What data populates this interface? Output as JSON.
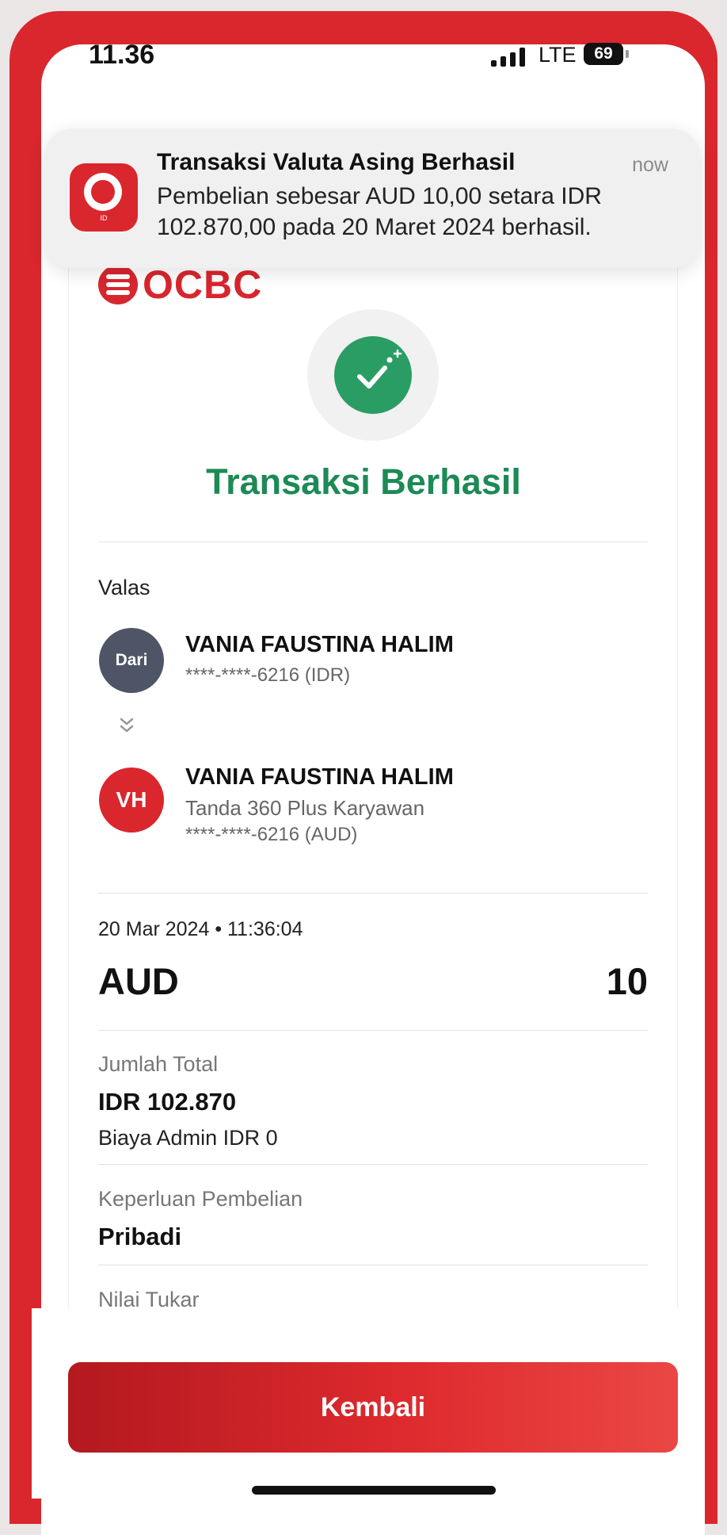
{
  "status_bar": {
    "time": "11.36",
    "network": "LTE",
    "battery": "69"
  },
  "notification": {
    "title": "Transaksi Valuta Asing Berhasil",
    "time": "now",
    "body_line1": "Pembelian sebesar AUD 10,00 setara IDR",
    "body_line2": "102.870,00 pada 20 Maret 2024 berhasil.",
    "app_icon_text": "ID"
  },
  "brand": {
    "name": "OCBC",
    "color": "#d8262e"
  },
  "result": {
    "title": "Transaksi Berhasil",
    "color": "#1d8a56"
  },
  "transfer": {
    "section_label": "Valas",
    "from": {
      "avatar": "Dari",
      "name": "VANIA FAUSTINA HALIM",
      "account": "****-****-6216 (IDR)"
    },
    "to": {
      "avatar": "VH",
      "name": "VANIA FAUSTINA HALIM",
      "product": "Tanda 360 Plus Karyawan",
      "account": "****-****-6216 (AUD)"
    }
  },
  "transaction": {
    "datetime": "20 Mar 2024 • 11:36:04",
    "currency": "AUD",
    "amount": "10"
  },
  "details": {
    "total_label": "Jumlah Total",
    "total_value": "IDR 102.870",
    "admin_fee": "Biaya Admin IDR 0",
    "purpose_label": "Keperluan Pembelian",
    "purpose_value": "Pribadi",
    "rate_label": "Nilai Tukar"
  },
  "actions": {
    "back_label": "Kembali"
  },
  "icons": {
    "signal": "signal-bars-icon",
    "success": "check-circle-icon",
    "arrow": "chevron-double-down-icon"
  }
}
